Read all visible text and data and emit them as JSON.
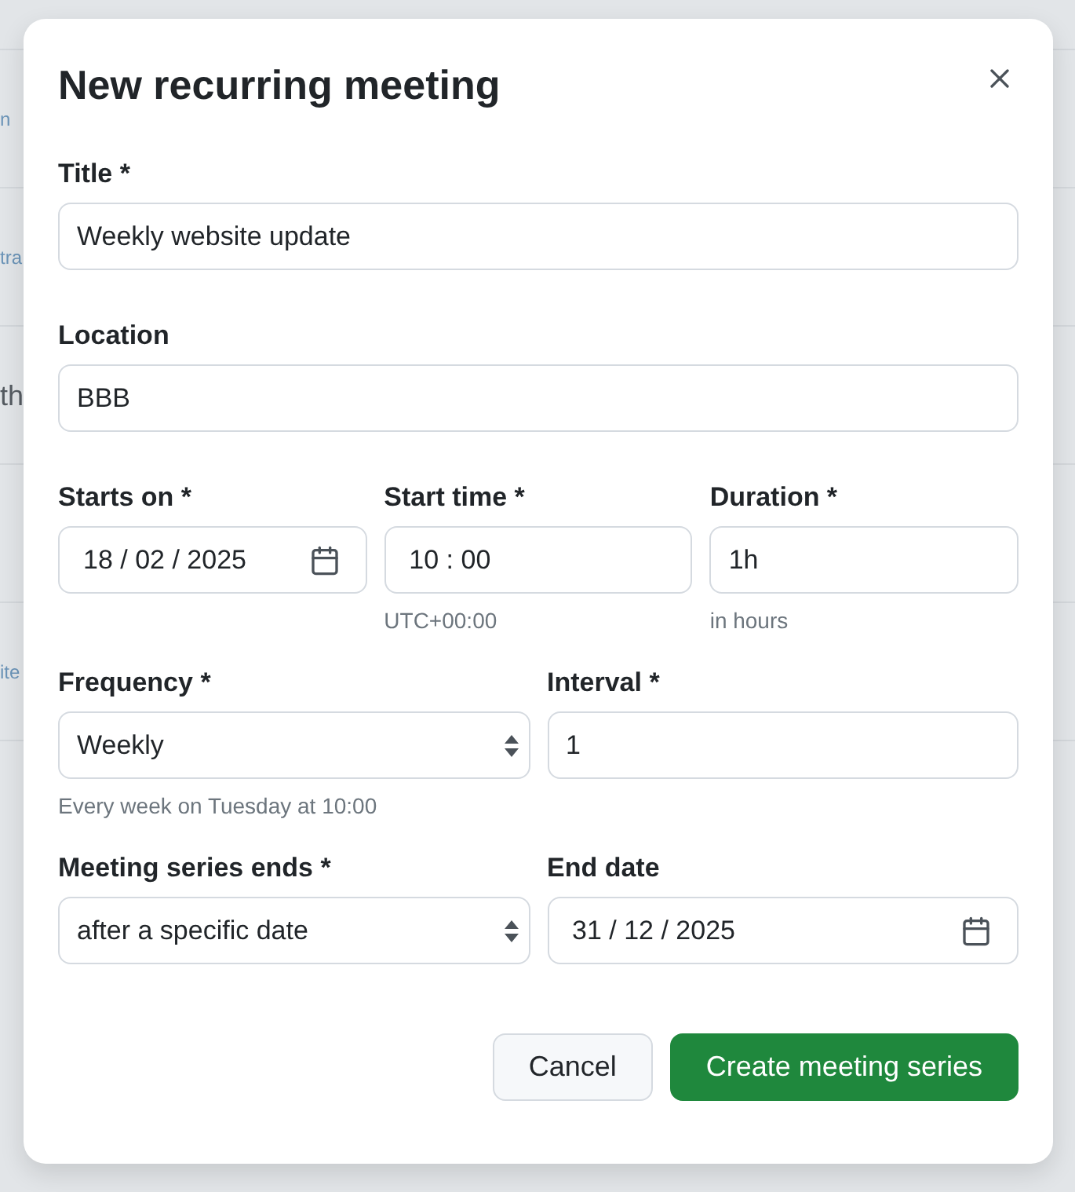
{
  "background": {
    "rows": [
      {
        "text": "n",
        "kind": "link"
      },
      {
        "text": "tra",
        "kind": "link"
      },
      {
        "text": "th",
        "kind": "heading"
      },
      {
        "kind": "empty"
      },
      {
        "text": "ite",
        "kind": "link"
      }
    ]
  },
  "dialog": {
    "title": "New recurring meeting",
    "rows": [
      {
        "fields": [
          {
            "label": "Title *",
            "kind": "text",
            "value": "Weekly website update"
          }
        ]
      },
      {
        "fields": [
          {
            "label": "Location",
            "kind": "text",
            "value": "BBB"
          }
        ]
      },
      {
        "fields": [
          {
            "label": "Starts on *",
            "kind": "date",
            "value": "18 / 02 / 2025"
          },
          {
            "label": "Start time *",
            "kind": "time",
            "value": "10 : 00",
            "hint": "UTC+00:00"
          },
          {
            "label": "Duration *",
            "kind": "text",
            "value": "1h",
            "hint": "in hours"
          }
        ]
      },
      {
        "fields": [
          {
            "label": "Frequency *",
            "kind": "select",
            "value": "Weekly",
            "hint": "Every week on Tuesday at 10:00"
          },
          {
            "label": "Interval *",
            "kind": "text",
            "value": "1"
          }
        ]
      },
      {
        "fields": [
          {
            "label": "Meeting series ends *",
            "kind": "select",
            "value": "after a specific date"
          },
          {
            "label": "End date",
            "kind": "date",
            "value": "31 / 12 / 2025"
          }
        ]
      }
    ],
    "buttons": [
      {
        "label": "Cancel",
        "kind": "secondary"
      },
      {
        "label": "Create meeting series",
        "kind": "primary"
      }
    ]
  }
}
